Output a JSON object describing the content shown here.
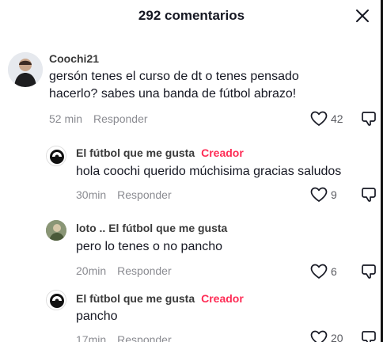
{
  "header": {
    "title": "292 comentarios"
  },
  "comments": [
    {
      "username": "Coochi21",
      "badge": "",
      "text": "gersón tenes el curso de dt o tenes pensado hacerlo? sabes una banda de fútbol abrazo!",
      "time": "52 min",
      "reply_label": "Responder",
      "likes": "42"
    },
    {
      "username": "El fútbol que me gusta",
      "badge": "Creador",
      "text": "hola coochi querido múchisima gracias saludos",
      "time": "30min",
      "reply_label": "Responder",
      "likes": "9"
    },
    {
      "username": "loto .. El fútbol que me gusta",
      "badge": "",
      "text": "pero lo tenes o no pancho",
      "time": "20min",
      "reply_label": "Responder",
      "likes": "6"
    },
    {
      "username": "El fùtbol que me gusta",
      "badge": "Creador",
      "text": "pancho",
      "time": "17min",
      "reply_label": "Responder",
      "likes": "20"
    }
  ],
  "colors": {
    "creator": "#fe2c55",
    "meta": "#8a8b91",
    "text": "#161823"
  }
}
